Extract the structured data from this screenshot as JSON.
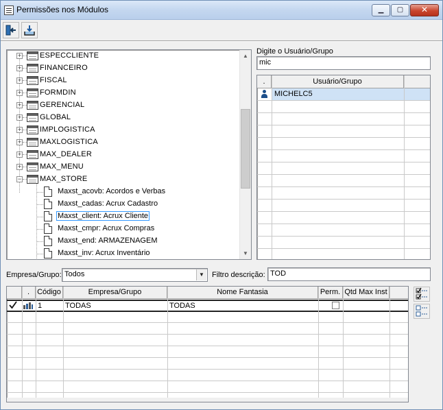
{
  "window": {
    "title": "Permissões nos Módulos",
    "min_glyph": "▁",
    "max_glyph": "▢",
    "close_glyph": "✕"
  },
  "toolbar": {
    "exit_icon": "exit-door-icon",
    "export_icon": "export-tray-icon"
  },
  "tree": {
    "nodes": [
      {
        "label": "ESPECCLIENTE",
        "expander": "+"
      },
      {
        "label": "FINANCEIRO",
        "expander": "+"
      },
      {
        "label": "FISCAL",
        "expander": "+"
      },
      {
        "label": "FORMDIN",
        "expander": "+"
      },
      {
        "label": "GERENCIAL",
        "expander": "+"
      },
      {
        "label": "GLOBAL",
        "expander": "+"
      },
      {
        "label": "IMPLOGISTICA",
        "expander": "+"
      },
      {
        "label": "MAXLOGISTICA",
        "expander": "+"
      },
      {
        "label": "MAX_DEALER",
        "expander": "+"
      },
      {
        "label": "MAX_MENU",
        "expander": "+"
      },
      {
        "label": "MAX_STORE",
        "expander": "−"
      }
    ],
    "children": [
      {
        "label": "Maxst_acovb: Acordos e Verbas"
      },
      {
        "label": "Maxst_cadas: Acrux Cadastro"
      },
      {
        "label": "Maxst_client: Acrux Cliente"
      },
      {
        "label": "Maxst_cmpr: Acrux Compras"
      },
      {
        "label": "Maxst_end: ARMAZENAGEM"
      },
      {
        "label": "Maxst_inv: Acrux Inventário"
      }
    ],
    "selected_child": 2
  },
  "user_search": {
    "label": "Digite o Usuário/Grupo",
    "value": "mic"
  },
  "user_grid": {
    "col_dot": ".",
    "col_user": "Usuário/Grupo",
    "rows": [
      {
        "name": "MICHELC5",
        "icon": "user-icon"
      }
    ]
  },
  "filters": {
    "empresa_label": "Empresa/Grupo:",
    "empresa_value": "Todos",
    "desc_label": "Filtro descrição:",
    "desc_value": "TOD"
  },
  "empresa_grid": {
    "columns": {
      "dot": ".",
      "codigo": "Código",
      "empresa": "Empresa/Grupo",
      "fantasia": "Nome Fantasia",
      "perm": "Perm.",
      "qtd": "Qtd Max Inst"
    },
    "rows": [
      {
        "codigo": "1",
        "empresa": "TODAS",
        "fantasia": "TODAS",
        "perm": false,
        "qtd": ""
      }
    ]
  },
  "side_buttons": [
    "check-all-icon",
    "uncheck-all-icon"
  ]
}
